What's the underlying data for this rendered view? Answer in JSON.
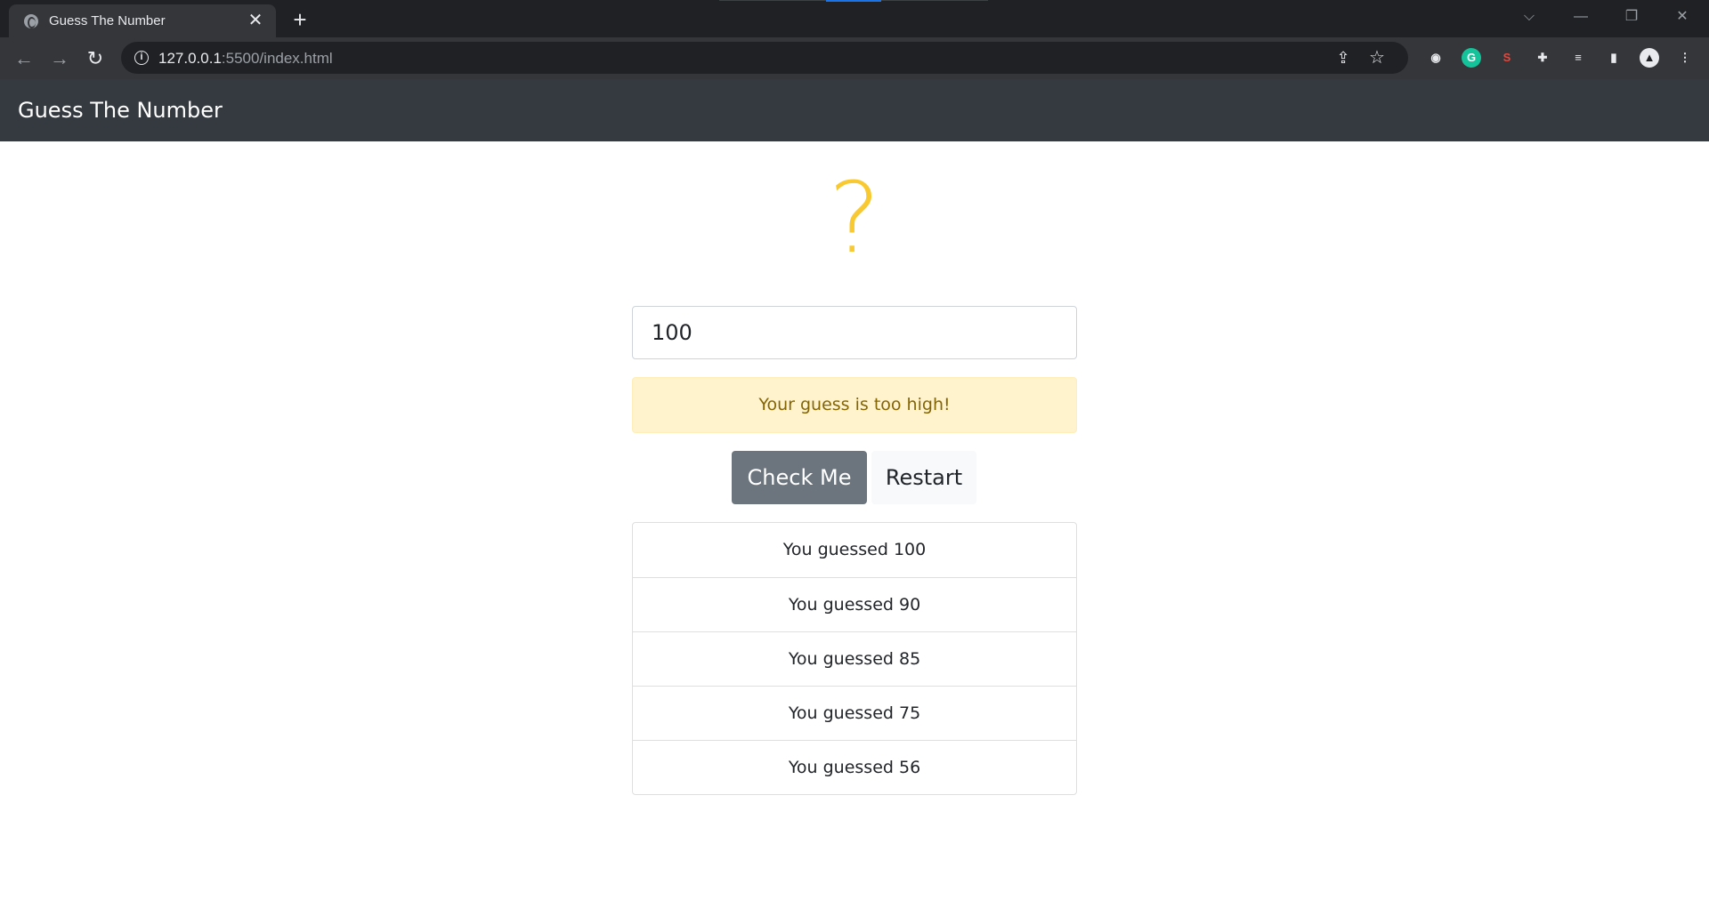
{
  "browser": {
    "tab_title": "Guess The Number",
    "close_glyph": "✕",
    "newtab_glyph": "+",
    "url_host": "127.0.0.1",
    "url_rest": ":5500/index.html",
    "back_glyph": "←",
    "forward_glyph": "→",
    "reload_glyph": "↻",
    "info_glyph": "i",
    "share_glyph": "⇪",
    "star_glyph": "☆",
    "extensions": [
      {
        "name": "color-picker-extension-icon",
        "glyph": "◉",
        "bg": "#35363a",
        "fg": "#e8eaed"
      },
      {
        "name": "grammarly-extension-icon",
        "glyph": "G",
        "bg": "#15c39a",
        "fg": "#ffffff"
      },
      {
        "name": "shield-extension-icon",
        "glyph": "S",
        "bg": "#35363a",
        "fg": "#e2483d"
      },
      {
        "name": "puzzle-extensions-icon",
        "glyph": "✚",
        "bg": "#35363a",
        "fg": "#e8eaed"
      },
      {
        "name": "reading-list-icon",
        "glyph": "≡",
        "bg": "#35363a",
        "fg": "#e8eaed"
      },
      {
        "name": "side-panel-icon",
        "glyph": "▮",
        "bg": "#35363a",
        "fg": "#e8eaed"
      },
      {
        "name": "profile-avatar-icon",
        "glyph": "▲",
        "bg": "#e8eaed",
        "fg": "#202124"
      },
      {
        "name": "kebab-menu-icon",
        "glyph": "⋮",
        "bg": "#35363a",
        "fg": "#e8eaed"
      }
    ],
    "window_controls": {
      "dropdown": "⌵",
      "minimize": "—",
      "restore": "❐",
      "close": "✕"
    }
  },
  "app": {
    "brand": "Guess The Number",
    "mystery_symbol": "?",
    "input_value": "100",
    "alert_text": "Your guess is too high!",
    "check_button": "Check Me",
    "restart_button": "Restart",
    "guesses": [
      "You guessed 100",
      "You guessed 90",
      "You guessed 85",
      "You guessed 75",
      "You guessed 56"
    ],
    "colors": {
      "alert_bg": "#fff3cd",
      "alert_text": "#856404",
      "question_mark": "#f9c932",
      "check_button": "#6c757d",
      "navbar": "#343a40"
    }
  }
}
